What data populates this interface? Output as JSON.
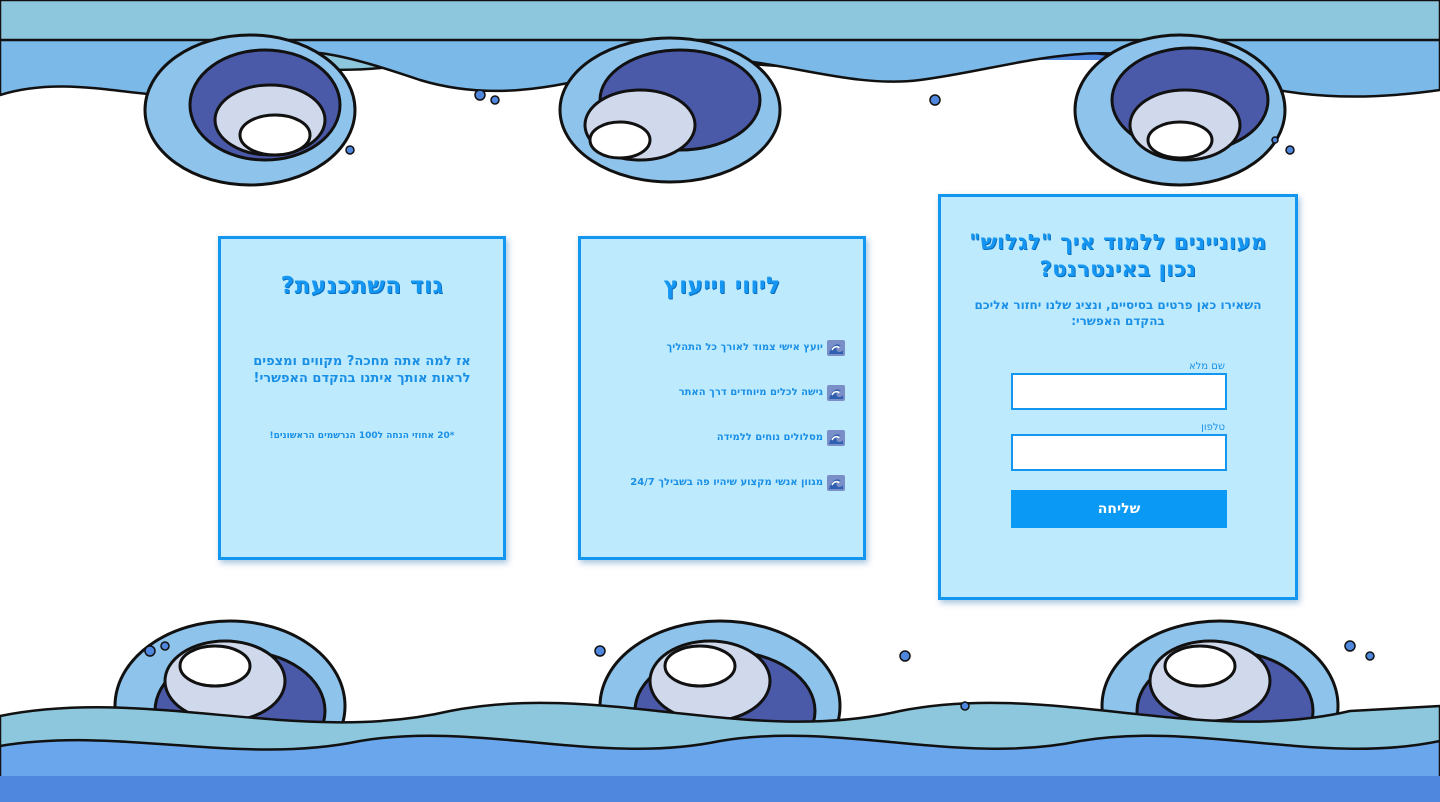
{
  "form_card": {
    "title": "מעוניינים ללמוד איך \"לגלוש\" נכון באינטרנט?",
    "subtitle": "השאירו כאן פרטים בסיסיים, ונציג שלנו יחזור אליכם בהקדם האפשרי:",
    "name_label": "שם מלא",
    "name_value": "",
    "phone_label": "טלפון",
    "phone_value": "",
    "submit_label": "שליחה"
  },
  "support_card": {
    "title": "ליווי וייעוץ",
    "items": [
      "יועץ אישי צמוד לאורך כל התהליך",
      "גישה לכלים מיוחדים דרך האתר",
      "מסלולים נוחים ללמידה",
      "מגוון אנשי מקצוע שיהיו פה בשבילך 24/7"
    ],
    "item_icon": "wave-icon"
  },
  "promo_card": {
    "title": "גוד השתכנעת?",
    "question": "אז למה אתה מחכה? מקווים ומצפים לראות אותך איתנו בהקדם האפשרי!",
    "discount": "*20 אחוזי הנחה ל100 הנרשמים הראשונים!"
  },
  "colors": {
    "card_bg": "#bdebfd",
    "card_border": "#1296f0",
    "accent": "#1496f2",
    "button": "#0a9af5",
    "wave_dark": "#4b5aa8",
    "wave_mid": "#6aa6ec",
    "wave_light": "#8ccbe0",
    "wave_pale": "#d0d9ec"
  }
}
